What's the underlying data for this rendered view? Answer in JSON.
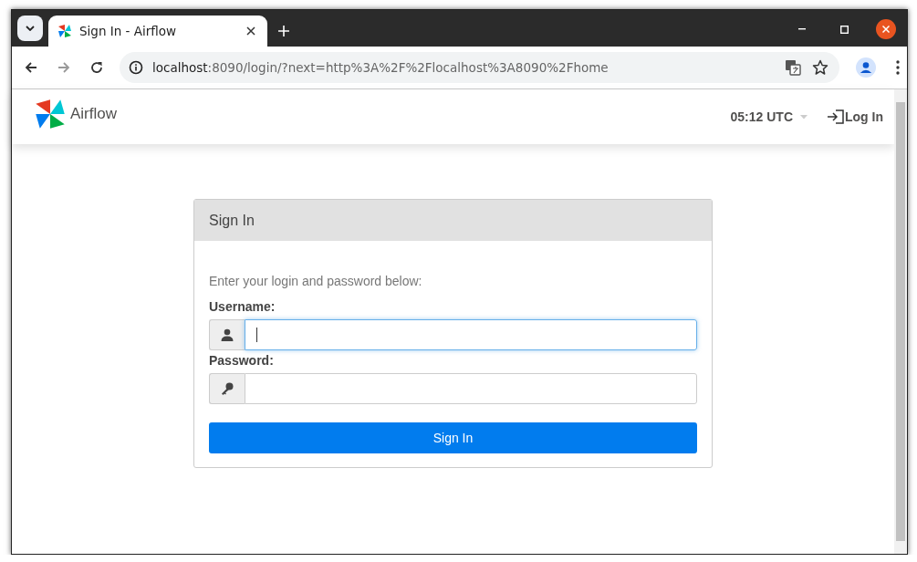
{
  "browser": {
    "tabs": [
      {
        "title": "Sign In - Airflow",
        "selected": true
      }
    ],
    "address": {
      "host": "localhost",
      "path": ":8090/login/?next=http%3A%2F%2Flocalhost%3A8090%2Fhome"
    }
  },
  "navbar": {
    "brand": "Airflow",
    "clock": "05:12 UTC",
    "login": "Log In"
  },
  "panel": {
    "title": "Sign In",
    "intro": "Enter your login and password below:",
    "fields": [
      {
        "kind": "user",
        "label": "Username:",
        "focused": true
      },
      {
        "kind": "password",
        "label": "Password:",
        "focused": false
      }
    ],
    "button": "Sign In"
  }
}
